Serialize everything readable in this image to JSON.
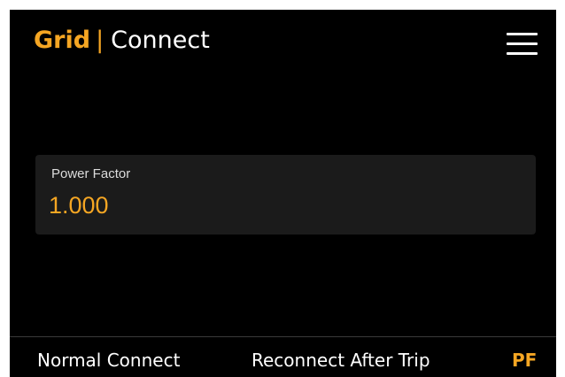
{
  "header": {
    "brand": "Grid",
    "separator": "|",
    "page": "Connect",
    "menu_icon": "hamburger-menu-icon"
  },
  "setting": {
    "label": "Power Factor",
    "value": "1.000"
  },
  "tabs": [
    {
      "label": "Normal Connect",
      "active": false
    },
    {
      "label": "Reconnect After Trip",
      "active": false
    },
    {
      "label": "PF",
      "active": true
    }
  ],
  "colors": {
    "accent": "#f5a623",
    "background": "#000000",
    "card": "#1b1b1b",
    "text": "#ffffff"
  }
}
